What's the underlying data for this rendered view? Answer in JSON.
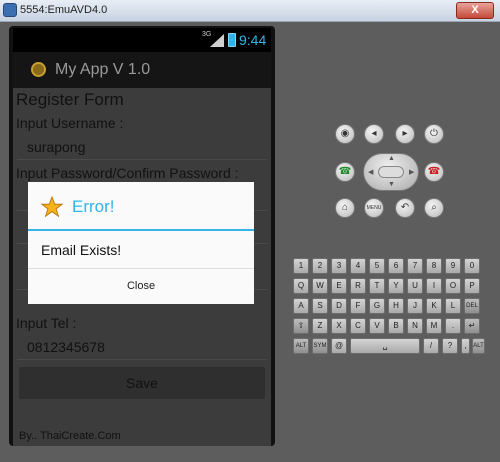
{
  "window": {
    "title": "5554:EmuAVD4.0",
    "close_label": "X"
  },
  "statusbar": {
    "network": "3G",
    "time": "9:44"
  },
  "actionbar": {
    "title": "My App V 1.0"
  },
  "form": {
    "title": "Register Form",
    "username_label": "Input Username :",
    "username_value": "surapong",
    "password_label": "Input Password/Confirm Password :",
    "tel_label": "Input Tel :",
    "tel_value": "0812345678",
    "save_label": "Save",
    "footer": "By.. ThaiCreate.Com"
  },
  "dialog": {
    "title": "Error!",
    "message": "Email Exists!",
    "button": "Close"
  },
  "hardware": {
    "camera": "◉",
    "vol_down": "◂",
    "vol_up": "▸",
    "power": "⏻",
    "call": "☎",
    "end": "☎",
    "home": "⌂",
    "menu": "MENU",
    "back": "↶",
    "search": "⌕"
  },
  "keyboard": {
    "row1": [
      "1",
      "2",
      "3",
      "4",
      "5",
      "6",
      "7",
      "8",
      "9",
      "0"
    ],
    "row2": [
      "Q",
      "W",
      "E",
      "R",
      "T",
      "Y",
      "U",
      "I",
      "O",
      "P"
    ],
    "row3": [
      "A",
      "S",
      "D",
      "F",
      "G",
      "H",
      "J",
      "K",
      "L",
      "DEL"
    ],
    "row4": [
      "⇧",
      "Z",
      "X",
      "C",
      "V",
      "B",
      "N",
      "M",
      ".",
      "↵"
    ],
    "row5": [
      "ALT",
      "SYM",
      "@",
      "␣",
      "/",
      "?",
      ",",
      "ALT"
    ]
  },
  "colors": {
    "accent": "#33b5e5",
    "background": "#5b5b5b"
  }
}
